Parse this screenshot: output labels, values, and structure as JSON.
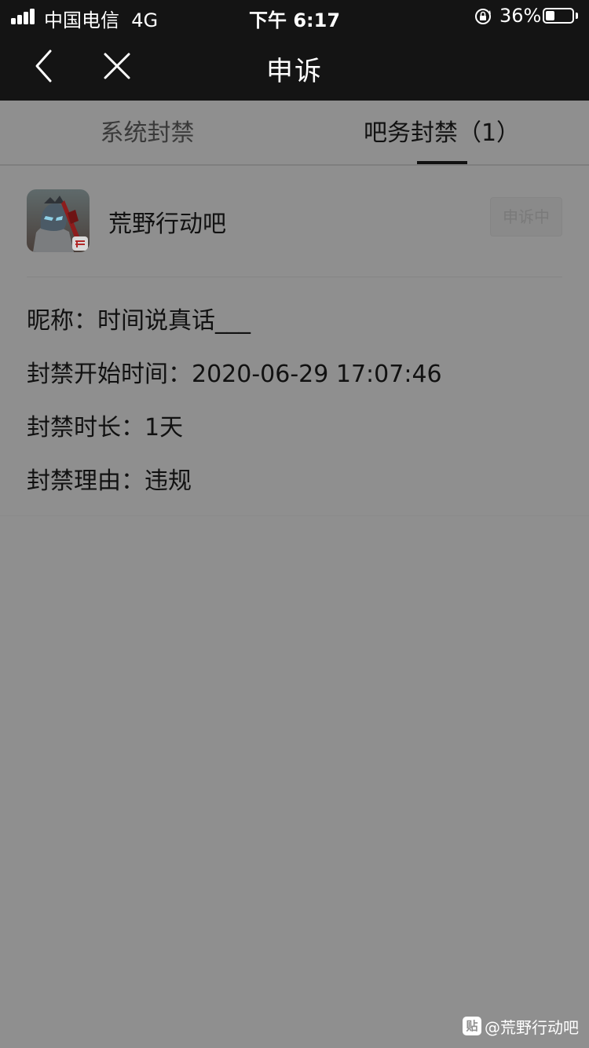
{
  "status_bar": {
    "carrier": "中国电信",
    "network": "4G",
    "time": "下午 6:17",
    "battery": "36%"
  },
  "nav": {
    "title": "申诉"
  },
  "tabs": [
    {
      "label": "系统封禁",
      "active": false
    },
    {
      "label": "吧务封禁（1）",
      "active": true
    }
  ],
  "ban": {
    "forum_name": "荒野行动吧",
    "status_button": "申诉中",
    "nickname": "昵称：时间说真话___",
    "start_time": "封禁开始时间：2020-06-29 17:07:46",
    "duration": "封禁时长：1天",
    "reason": "封禁理由：违规"
  },
  "watermark": {
    "icon_char": "贴",
    "text": "@荒野行动吧"
  },
  "colors": {
    "header_bg": "#141414",
    "dimmed_bg": "#8f8f8f",
    "text": "#111111"
  }
}
